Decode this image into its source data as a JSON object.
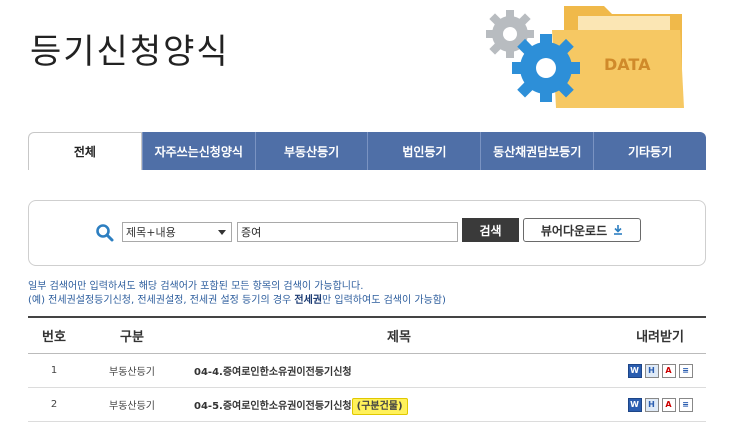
{
  "page": {
    "title": "등기신청양식"
  },
  "illustration": {
    "label": "DATA"
  },
  "tabs": [
    {
      "label": "전체",
      "active": true
    },
    {
      "label": "자주쓰는신청양식",
      "active": false
    },
    {
      "label": "부동산등기",
      "active": false
    },
    {
      "label": "법인등기",
      "active": false
    },
    {
      "label": "동산채권담보등기",
      "active": false
    },
    {
      "label": "기타등기",
      "active": false
    }
  ],
  "search": {
    "select_value": "제목+내용",
    "query": "증여",
    "search_button": "검색",
    "viewer_download_button": "뷰어다운로드"
  },
  "notes": {
    "line1": "일부 검색어만 입력하셔도 해당 검색어가 포함된 모든 항목의 검색이 가능합니다.",
    "line2_prefix": "(예) 전세권설정등기신청, 전세권설정, 전세권 설정 등기의 경우 ",
    "line2_bold": "전세권",
    "line2_suffix": "만 입력하여도 검색이 가능함)"
  },
  "table": {
    "headers": {
      "no": "번호",
      "category": "구분",
      "title": "제목",
      "download": "내려받기"
    },
    "rows": [
      {
        "no": "1",
        "category": "부동산등기",
        "title": "04-4.증여로인한소유권이전등기신청",
        "highlight": ""
      },
      {
        "no": "2",
        "category": "부동산등기",
        "title": "04-5.증여로인한소유권이전등기신청",
        "highlight": "(구분건물)"
      }
    ],
    "file_icons": [
      "word-icon",
      "hwp-icon",
      "pdf-icon",
      "text-file-icon"
    ]
  },
  "colors": {
    "tab_bg": "#4f6fa7",
    "note_text": "#2c5d9d",
    "highlight": "#fff15a"
  }
}
